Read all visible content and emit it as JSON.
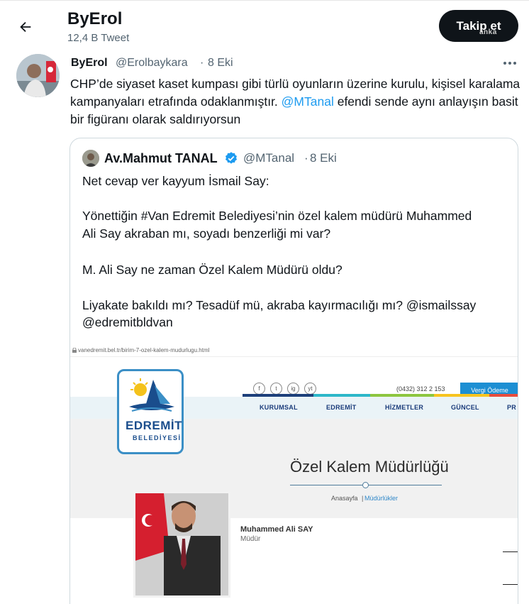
{
  "header": {
    "name": "ByErol",
    "tweet_count": "12,4 B Tweet",
    "follow_label": "Takip et",
    "watermark": "anka"
  },
  "tweet": {
    "name": "ByErol",
    "handle": "@Erolbaykara",
    "dot": "·",
    "time": "8 Eki",
    "text_before": "CHP’de siyaset kaset kumpası gibi türlü oyunların üzerine kurulu, kişisel karalama kampanyaları etrafında odaklanmıştır. ",
    "mention": "@MTanal",
    "text_after": " efendi sende aynı anlayışın basit bir figüranı olarak saldırıyorsun"
  },
  "quote": {
    "name": "Av.Mahmut TANAL",
    "handle": "@MTanal",
    "dot": "·",
    "time": "8 Eki",
    "lines": [
      "Net cevap ver kayyum İsmail Say:",
      "Yönettiğin #Van Edremit Belediyesi’nin özel kalem müdürü Muhammed",
      "Ali Say akraban mı, soyadı benzerliği mi var?",
      "M. Ali Say ne zaman Özel Kalem Müdürü oldu?",
      "Liyakate bakıldı mı? Tesadüf mü, akraba kayırmacılığı mı? @ismailssay",
      "@edremitbldvan"
    ]
  },
  "web": {
    "url": "vanedremit.bel.tr/birim-7-ozel-kalem-mudurlugu.html",
    "phone": "(0432) 312 2 153",
    "vergi_button": "Vergi Ödeme",
    "social": [
      "f",
      "t",
      "ig",
      "yt"
    ],
    "nav": [
      "KURUMSAL",
      "EDREMİT",
      "HİZMETLER",
      "GÜNCEL",
      "PR"
    ],
    "logo_title": "EDREMİT",
    "logo_subtitle": "BELEDİYESİ",
    "page_heading": "Özel Kalem Müdürlüğü",
    "crumb_home": "Anasayfa",
    "crumb_sep": "|",
    "crumb_current": "Müdürlükler",
    "person_name": "Muhammed Ali SAY",
    "person_role": "Müdür",
    "colors": {
      "bar": [
        "#1d3f7a",
        "#2db7c9",
        "#8dc63f",
        "#f7c41f",
        "#e74c3c"
      ],
      "accent": "#1c8fd3",
      "band": "#eaf3f7"
    }
  }
}
